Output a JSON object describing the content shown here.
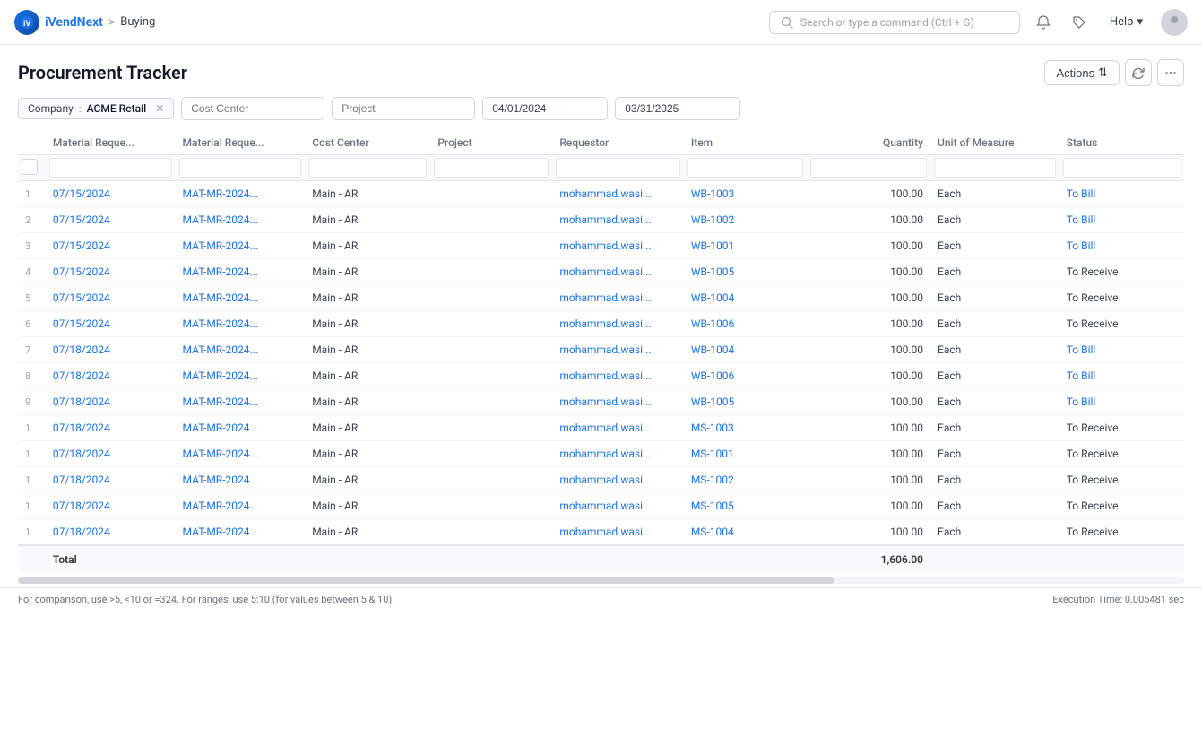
{
  "app": {
    "logo_text": "iV",
    "name": "iVendNext",
    "separator": ">",
    "module": "Buying"
  },
  "nav": {
    "search_placeholder": "Search or type a command (Ctrl + G)",
    "help_label": "Help",
    "chevron": "▾"
  },
  "page": {
    "title": "Procurement Tracker",
    "actions_label": "Actions",
    "refresh_title": "Refresh",
    "more_title": "More options"
  },
  "filters": {
    "company": "ACME Retail",
    "cost_center_placeholder": "Cost Center",
    "project_placeholder": "Project",
    "from_date": "04/01/2024",
    "to_date": "03/31/2025"
  },
  "table": {
    "columns": [
      {
        "key": "row_num",
        "label": ""
      },
      {
        "key": "mr_date",
        "label": "Material Reque..."
      },
      {
        "key": "mr_no",
        "label": "Material Reque..."
      },
      {
        "key": "cost_center",
        "label": "Cost Center"
      },
      {
        "key": "project",
        "label": "Project"
      },
      {
        "key": "requestor",
        "label": "Requestor"
      },
      {
        "key": "item",
        "label": "Item"
      },
      {
        "key": "quantity",
        "label": "Quantity"
      },
      {
        "key": "uom",
        "label": "Unit of Measure"
      },
      {
        "key": "status",
        "label": "Status"
      }
    ],
    "rows": [
      {
        "row_num": "1",
        "mr_date": "07/15/2024",
        "mr_no": "MAT-MR-2024...",
        "cost_center": "Main - AR",
        "project": "",
        "requestor": "mohammad.wasi...",
        "item": "WB-1003",
        "quantity": "100.00",
        "uom": "Each",
        "status": "To Bill",
        "status_class": "status-tobill"
      },
      {
        "row_num": "2",
        "mr_date": "07/15/2024",
        "mr_no": "MAT-MR-2024...",
        "cost_center": "Main - AR",
        "project": "",
        "requestor": "mohammad.wasi...",
        "item": "WB-1002",
        "quantity": "100.00",
        "uom": "Each",
        "status": "To Bill",
        "status_class": "status-tobill"
      },
      {
        "row_num": "3",
        "mr_date": "07/15/2024",
        "mr_no": "MAT-MR-2024...",
        "cost_center": "Main - AR",
        "project": "",
        "requestor": "mohammad.wasi...",
        "item": "WB-1001",
        "quantity": "100.00",
        "uom": "Each",
        "status": "To Bill",
        "status_class": "status-tobill"
      },
      {
        "row_num": "4",
        "mr_date": "07/15/2024",
        "mr_no": "MAT-MR-2024...",
        "cost_center": "Main - AR",
        "project": "",
        "requestor": "mohammad.wasi...",
        "item": "WB-1005",
        "quantity": "100.00",
        "uom": "Each",
        "status": "To Receive",
        "status_class": "status-toreceive"
      },
      {
        "row_num": "5",
        "mr_date": "07/15/2024",
        "mr_no": "MAT-MR-2024...",
        "cost_center": "Main - AR",
        "project": "",
        "requestor": "mohammad.wasi...",
        "item": "WB-1004",
        "quantity": "100.00",
        "uom": "Each",
        "status": "To Receive",
        "status_class": "status-toreceive"
      },
      {
        "row_num": "6",
        "mr_date": "07/15/2024",
        "mr_no": "MAT-MR-2024...",
        "cost_center": "Main - AR",
        "project": "",
        "requestor": "mohammad.wasi...",
        "item": "WB-1006",
        "quantity": "100.00",
        "uom": "Each",
        "status": "To Receive",
        "status_class": "status-toreceive"
      },
      {
        "row_num": "7",
        "mr_date": "07/18/2024",
        "mr_no": "MAT-MR-2024...",
        "cost_center": "Main - AR",
        "project": "",
        "requestor": "mohammad.wasi...",
        "item": "WB-1004",
        "quantity": "100.00",
        "uom": "Each",
        "status": "To Bill",
        "status_class": "status-tobill"
      },
      {
        "row_num": "8",
        "mr_date": "07/18/2024",
        "mr_no": "MAT-MR-2024...",
        "cost_center": "Main - AR",
        "project": "",
        "requestor": "mohammad.wasi...",
        "item": "WB-1006",
        "quantity": "100.00",
        "uom": "Each",
        "status": "To Bill",
        "status_class": "status-tobill"
      },
      {
        "row_num": "9",
        "mr_date": "07/18/2024",
        "mr_no": "MAT-MR-2024...",
        "cost_center": "Main - AR",
        "project": "",
        "requestor": "mohammad.wasi...",
        "item": "WB-1005",
        "quantity": "100.00",
        "uom": "Each",
        "status": "To Bill",
        "status_class": "status-tobill"
      },
      {
        "row_num": "1...",
        "mr_date": "07/18/2024",
        "mr_no": "MAT-MR-2024...",
        "cost_center": "Main - AR",
        "project": "",
        "requestor": "mohammad.wasi...",
        "item": "MS-1003",
        "quantity": "100.00",
        "uom": "Each",
        "status": "To Receive",
        "status_class": "status-toreceive"
      },
      {
        "row_num": "1...",
        "mr_date": "07/18/2024",
        "mr_no": "MAT-MR-2024...",
        "cost_center": "Main - AR",
        "project": "",
        "requestor": "mohammad.wasi...",
        "item": "MS-1001",
        "quantity": "100.00",
        "uom": "Each",
        "status": "To Receive",
        "status_class": "status-toreceive"
      },
      {
        "row_num": "1...",
        "mr_date": "07/18/2024",
        "mr_no": "MAT-MR-2024...",
        "cost_center": "Main - AR",
        "project": "",
        "requestor": "mohammad.wasi...",
        "item": "MS-1002",
        "quantity": "100.00",
        "uom": "Each",
        "status": "To Receive",
        "status_class": "status-toreceive"
      },
      {
        "row_num": "1...",
        "mr_date": "07/18/2024",
        "mr_no": "MAT-MR-2024...",
        "cost_center": "Main - AR",
        "project": "",
        "requestor": "mohammad.wasi...",
        "item": "MS-1005",
        "quantity": "100.00",
        "uom": "Each",
        "status": "To Receive",
        "status_class": "status-toreceive"
      },
      {
        "row_num": "1...",
        "mr_date": "07/18/2024",
        "mr_no": "MAT-MR-2024...",
        "cost_center": "Main - AR",
        "project": "",
        "requestor": "mohammad.wasi...",
        "item": "MS-1004",
        "quantity": "100.00",
        "uom": "Each",
        "status": "To Receive",
        "status_class": "status-toreceive"
      }
    ],
    "total_label": "Total",
    "total_quantity": "1,606.00"
  },
  "footer": {
    "hint": "For comparison, use >5, <10 or =324. For ranges, use 5:10 (for values between 5 & 10).",
    "execution": "Execution Time: 0.005481 sec"
  }
}
